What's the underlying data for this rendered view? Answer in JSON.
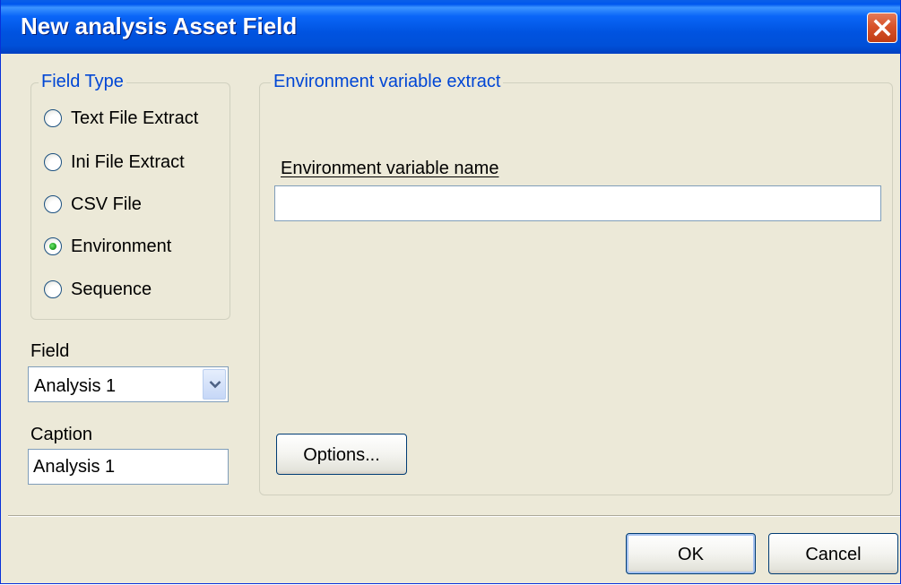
{
  "window": {
    "title": "New analysis Asset Field"
  },
  "field_type": {
    "legend": "Field Type",
    "options": [
      {
        "label": "Text File Extract",
        "selected": false
      },
      {
        "label": "Ini File Extract",
        "selected": false
      },
      {
        "label": "CSV File",
        "selected": false
      },
      {
        "label": "Environment",
        "selected": true
      },
      {
        "label": "Sequence",
        "selected": false
      }
    ]
  },
  "field": {
    "label": "Field",
    "value": "Analysis 1"
  },
  "caption": {
    "label": "Caption",
    "value": "Analysis 1"
  },
  "extract": {
    "legend": "Environment variable extract",
    "var_label": "Environment variable name",
    "var_value": "",
    "options_button": "Options..."
  },
  "footer": {
    "ok": "OK",
    "cancel": "Cancel"
  },
  "icons": {
    "close": "close-icon",
    "dropdown": "chevron-down-icon"
  }
}
